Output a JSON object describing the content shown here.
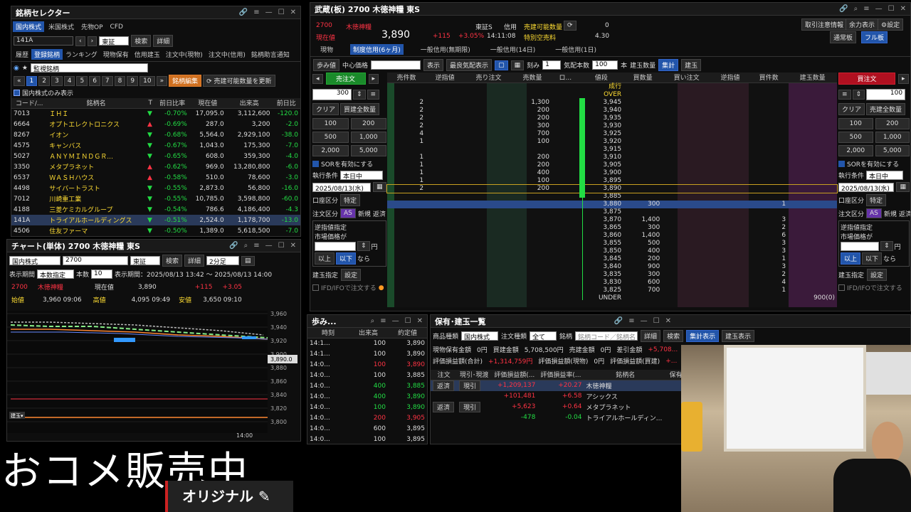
{
  "selector": {
    "title": "銘柄セレクター",
    "tabs": [
      "国内株式",
      "米国株式",
      "先物OP",
      "CFD"
    ],
    "code_value": "141A",
    "market": "東証",
    "search_label": "検索",
    "detail_label": "詳細",
    "subtabs": [
      "履歴",
      "登録銘柄",
      "ランキング",
      "現物保有",
      "信用建玉",
      "注文中(現物)",
      "注文中(信用)",
      "銘柄助言通知"
    ],
    "list_name": "監視銘柄",
    "pages": [
      "1",
      "2",
      "3",
      "4",
      "5",
      "6",
      "7",
      "8",
      "9",
      "10"
    ],
    "edit_label": "銘柄編集",
    "sellable_label": "売建可能数量を更新",
    "domestic_only": "国内株式のみ表示",
    "headers": [
      "コード/...",
      "銘柄名",
      "T",
      "前日比率",
      "現在値",
      "出来高",
      "前日比"
    ],
    "rows": [
      {
        "code": "7013",
        "name": "ＩＨＩ",
        "dir": "▼",
        "pct": "-0.70%",
        "price": "17,095.0",
        "vol": "3,112,600",
        "chg": "-120.0"
      },
      {
        "code": "6664",
        "name": "オプトエレクトロニクス",
        "dir": "▲",
        "pct": "-0.69%",
        "price": "287.0",
        "vol": "3,200",
        "chg": "-2.0"
      },
      {
        "code": "8267",
        "name": "イオン",
        "dir": "▼",
        "pct": "-0.68%",
        "price": "5,564.0",
        "vol": "2,929,100",
        "chg": "-38.0"
      },
      {
        "code": "4575",
        "name": "キャンバス",
        "dir": "▼",
        "pct": "-0.67%",
        "price": "1,043.0",
        "vol": "175,300",
        "chg": "-7.0"
      },
      {
        "code": "5027",
        "name": "ＡＮＹＭＩＮＤＧＲ...",
        "dir": "▼",
        "pct": "-0.65%",
        "price": "608.0",
        "vol": "359,300",
        "chg": "-4.0"
      },
      {
        "code": "3350",
        "name": "メタプラネット",
        "dir": "▲",
        "pct": "-0.62%",
        "price": "969.0",
        "vol": "13,280,800",
        "chg": "-6.0"
      },
      {
        "code": "6537",
        "name": "ＷＡＳＨハウス",
        "dir": "▲",
        "pct": "-0.58%",
        "price": "510.0",
        "vol": "78,600",
        "chg": "-3.0"
      },
      {
        "code": "4498",
        "name": "サイバートラスト",
        "dir": "▼",
        "pct": "-0.55%",
        "price": "2,873.0",
        "vol": "56,800",
        "chg": "-16.0"
      },
      {
        "code": "7012",
        "name": "川崎重工業",
        "dir": "▼",
        "pct": "-0.55%",
        "price": "10,785.0",
        "vol": "3,598,800",
        "chg": "-60.0"
      },
      {
        "code": "4188",
        "name": "三菱ケミカルグループ",
        "dir": "▼",
        "pct": "-0.54%",
        "price": "786.6",
        "vol": "4,186,400",
        "chg": "-4.3"
      },
      {
        "code": "141A",
        "name": "トライアルホールディングス",
        "dir": "▼",
        "pct": "-0.51%",
        "price": "2,524.0",
        "vol": "1,178,700",
        "chg": "-13.0"
      },
      {
        "code": "4506",
        "name": "住友ファーマ",
        "dir": "▼",
        "pct": "-0.50%",
        "price": "1,389.0",
        "vol": "5,618,500",
        "chg": "-7.0"
      }
    ]
  },
  "chart": {
    "title": "チャート(単体) 2700 木徳神糧 東S",
    "market": "国内株式",
    "code": "2700",
    "exchange": "東証",
    "search_label": "検索",
    "detail_label": "詳細",
    "interval": "2分足",
    "display_period_label": "表示期間",
    "display_mode": "本数指定",
    "bars_label": "本数",
    "bars": "10",
    "period_text": "表示期間：2025/08/13 13:42 ～ 2025/08/13 14:00",
    "code_small": "2700",
    "name_small": "木徳神糧",
    "current_label": "現在値",
    "current": "3,890",
    "change": "+115",
    "change_pct": "+3.05",
    "open_label": "始値",
    "open": "3,960 09:06",
    "high_label": "高値",
    "high": "4,095 09:49",
    "low_label": "安値",
    "low": "3,650 09:10",
    "y_ticks": [
      "3,960",
      "3,940",
      "3,920",
      "3,900",
      "3,880",
      "3,860",
      "3,840",
      "3,820",
      "3,800"
    ],
    "price_tag": "3,890.0",
    "x_label": "14:00",
    "legend_tag": "建玉▾"
  },
  "board": {
    "title": "武蔵(板) 2700 木徳神糧 東S",
    "code": "2700",
    "name": "木徳神糧",
    "market": "東証S",
    "credit_label": "信用",
    "sellable_label": "売建可能数量",
    "sellable_value": "0",
    "current_label": "現在値",
    "price": "3,890",
    "change": "+115",
    "change_pct": "+3.05%",
    "time": "14:11:08",
    "special_label": "特別空売料",
    "special_value": "4.30",
    "top_buttons": [
      "取引注意情報",
      "余力表示",
      "設定"
    ],
    "view_buttons": [
      "通常板",
      "フル板"
    ],
    "tabs": [
      "現物",
      "制度信用(6ヶ月)",
      "一般信用(無期限)",
      "一般信用(14日)",
      "一般信用(1日)"
    ],
    "toolbar": [
      "歩み値",
      "中心価格",
      "表示",
      "最良気配表示",
      "刻み",
      "1",
      "気配本数",
      "100",
      "本",
      "建玉数量",
      "集計",
      "建玉"
    ],
    "sell_order": "売注文",
    "buy_order": "買注文",
    "headers": [
      "売件数",
      "逆指値",
      "売り注文",
      "売数量",
      "ロ...",
      "値段",
      "買数量",
      "買い注文",
      "逆指値",
      "買件数",
      "建玉数量"
    ],
    "market_row": "成行",
    "over_row": "OVER",
    "under_row": "UNDER",
    "under_qty": "900(0)",
    "asks": [
      {
        "cnt": "2",
        "qty": "1,300",
        "price": "3,945"
      },
      {
        "cnt": "2",
        "qty": "200",
        "price": "3,940"
      },
      {
        "cnt": "2",
        "qty": "200",
        "price": "3,935"
      },
      {
        "cnt": "2",
        "qty": "300",
        "price": "3,930"
      },
      {
        "cnt": "4",
        "qty": "700",
        "price": "3,925"
      },
      {
        "cnt": "1",
        "qty": "100",
        "price": "3,920"
      },
      {
        "cnt": "",
        "qty": "",
        "price": "3,915"
      },
      {
        "cnt": "1",
        "qty": "200",
        "price": "3,910"
      },
      {
        "cnt": "1",
        "qty": "200",
        "price": "3,905"
      },
      {
        "cnt": "1",
        "qty": "400",
        "price": "3,900"
      },
      {
        "cnt": "1",
        "qty": "100",
        "price": "3,895"
      },
      {
        "cnt": "2",
        "qty": "200",
        "price": "3,890"
      }
    ],
    "bids": [
      {
        "price": "3,885",
        "qty": "",
        "cnt": ""
      },
      {
        "price": "3,880",
        "qty": "300",
        "cnt": "1"
      },
      {
        "price": "3,875",
        "qty": "",
        "cnt": ""
      },
      {
        "price": "3,870",
        "qty": "1,400",
        "cnt": "3"
      },
      {
        "price": "3,865",
        "qty": "300",
        "cnt": "2"
      },
      {
        "price": "3,860",
        "qty": "1,400",
        "cnt": "6"
      },
      {
        "price": "3,855",
        "qty": "500",
        "cnt": "3"
      },
      {
        "price": "3,850",
        "qty": "400",
        "cnt": "3"
      },
      {
        "price": "3,845",
        "qty": "200",
        "cnt": "1"
      },
      {
        "price": "3,840",
        "qty": "900",
        "cnt": "3"
      },
      {
        "price": "3,835",
        "qty": "300",
        "cnt": "2"
      },
      {
        "price": "3,830",
        "qty": "600",
        "cnt": "4"
      },
      {
        "price": "3,825",
        "qty": "700",
        "cnt": "1"
      }
    ],
    "side": {
      "qty_left": "300",
      "qty_right": "100",
      "clear_label": "クリア",
      "buy_all": "買建全数量",
      "sell_all": "売建全数量",
      "lots": [
        "100",
        "200",
        "500",
        "1,000",
        "2,000",
        "5,000"
      ],
      "sor_label": "SORを有効にする",
      "exec_label": "執行条件",
      "exec_value": "本日中",
      "date_value": "2025/08/13(水)",
      "account_label": "口座区分",
      "account_value": "特定",
      "order_type_label": "注文区分",
      "order_types": [
        "新規",
        "返済"
      ],
      "stop_label": "逆指値指定",
      "market_price_label": "市場価格が",
      "yen": "円",
      "above": "以上",
      "below": "以下",
      "then": "なら",
      "position_label": "建玉指定",
      "set_label": "設定",
      "ifd_label": "IFD/IFOで注文する"
    }
  },
  "ticks": {
    "title": "歩み...",
    "headers": [
      "時刻",
      "出来高",
      "約定値"
    ],
    "rows": [
      {
        "t": "14:1...",
        "v": "100",
        "p": "3,890",
        "c": "n"
      },
      {
        "t": "14:1...",
        "v": "100",
        "p": "3,890",
        "c": "n"
      },
      {
        "t": "14:0...",
        "v": "100",
        "p": "3,890",
        "c": "r"
      },
      {
        "t": "14:0...",
        "v": "100",
        "p": "3,885",
        "c": "n"
      },
      {
        "t": "14:0...",
        "v": "400",
        "p": "3,885",
        "c": "g"
      },
      {
        "t": "14:0...",
        "v": "400",
        "p": "3,890",
        "c": "g"
      },
      {
        "t": "14:0...",
        "v": "100",
        "p": "3,890",
        "c": "g"
      },
      {
        "t": "14:0...",
        "v": "200",
        "p": "3,905",
        "c": "r"
      },
      {
        "t": "14:0...",
        "v": "600",
        "p": "3,895",
        "c": "n"
      },
      {
        "t": "14:0...",
        "v": "100",
        "p": "3,895",
        "c": "n"
      }
    ]
  },
  "positions": {
    "title": "保有･建玉一覧",
    "product_label": "商品種類",
    "product_value": "国内株式",
    "order_kind_label": "注文種類",
    "order_kind_value": "全て",
    "stock_label": "銘柄",
    "stock_placeholder": "銘柄コード／銘柄名",
    "detail": "詳細",
    "search": "検索",
    "total_view": "集計表示",
    "position_view": "建玉表示",
    "summary1": [
      {
        "label": "現物保有金額",
        "value": "0円"
      },
      {
        "label": "買建金額",
        "value": "5,708,500円"
      },
      {
        "label": "売建金額",
        "value": "0円"
      },
      {
        "label": "差引金額",
        "value": "+5,708..."
      }
    ],
    "summary2": [
      {
        "label": "評価損益額(合計)",
        "value": "+1,314,759円"
      },
      {
        "label": "評価損益額(現物)",
        "value": "0円"
      },
      {
        "label": "評価損益額(買建)",
        "value": "+..."
      }
    ],
    "headers": [
      "注文",
      "現引･現渡",
      "評価損益額(...",
      "評価損益率(...",
      "銘柄名",
      "保有/"
    ],
    "rows": [
      {
        "a": "返済",
        "b": "現引",
        "pl": "+1,209,137",
        "pct": "+20.27",
        "name": "木徳神糧"
      },
      {
        "a": "",
        "b": "",
        "pl": "+101,481",
        "pct": "+6.58",
        "name": "アシックス"
      },
      {
        "a": "返済",
        "b": "現引",
        "pl": "+5,623",
        "pct": "+0.64",
        "name": "メタプラネット"
      },
      {
        "a": "",
        "b": "",
        "pl": "-478",
        "pct": "-0.04",
        "name": "トライアルホールディン..."
      }
    ]
  },
  "overlay": {
    "big_text": "おコメ販売中",
    "original": "オリジナル"
  }
}
